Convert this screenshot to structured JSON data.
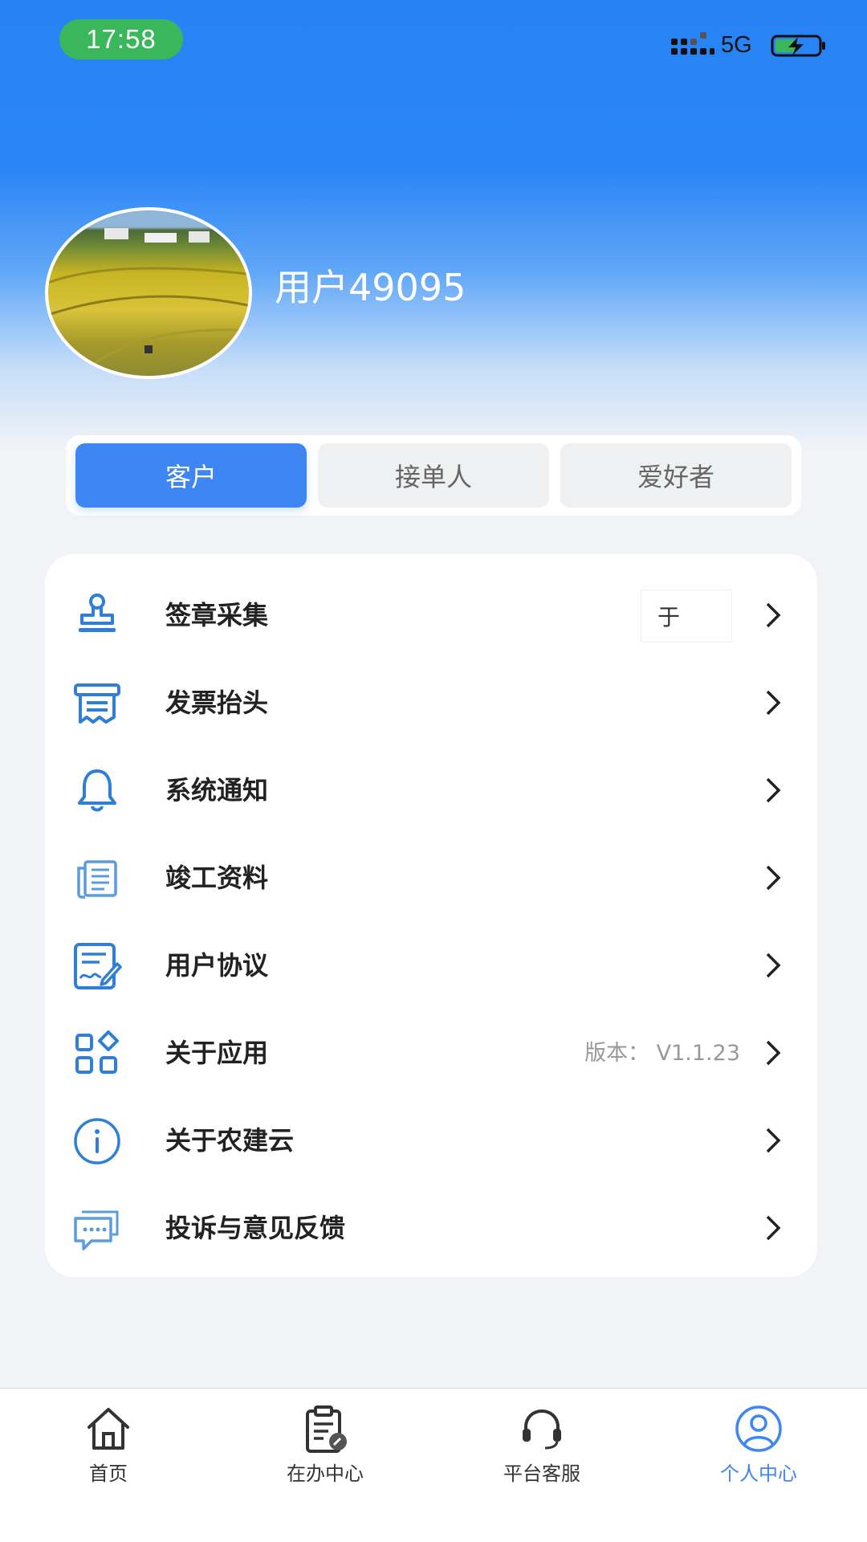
{
  "status_bar": {
    "time": "17:58",
    "network": "5G"
  },
  "profile": {
    "username": "用户49095"
  },
  "role_tabs": [
    {
      "label": "客户",
      "selected": true
    },
    {
      "label": "接单人",
      "selected": false
    },
    {
      "label": "爱好者",
      "selected": false
    }
  ],
  "menu": {
    "items": [
      {
        "label": "签章采集",
        "icon": "stamp-icon",
        "signature_text": "于"
      },
      {
        "label": "发票抬头",
        "icon": "invoice-icon"
      },
      {
        "label": "系统通知",
        "icon": "bell-icon"
      },
      {
        "label": "竣工资料",
        "icon": "documents-icon"
      },
      {
        "label": "用户协议",
        "icon": "agreement-icon"
      },
      {
        "label": "关于应用",
        "icon": "apps-icon",
        "extra": "版本： V1.1.23"
      },
      {
        "label": "关于农建云",
        "icon": "info-icon"
      },
      {
        "label": "投诉与意见反馈",
        "icon": "feedback-icon"
      }
    ]
  },
  "bottom_nav": [
    {
      "label": "首页",
      "icon": "home-icon",
      "active": false
    },
    {
      "label": "在办中心",
      "icon": "clipboard-icon",
      "active": false
    },
    {
      "label": "平台客服",
      "icon": "headset-icon",
      "active": false
    },
    {
      "label": "个人中心",
      "icon": "user-icon",
      "active": true
    }
  ],
  "colors": {
    "accent": "#3d86f3",
    "header": "#2782f4",
    "time_pill": "#3bb75b",
    "icon_blue": "#2f7fd6"
  }
}
